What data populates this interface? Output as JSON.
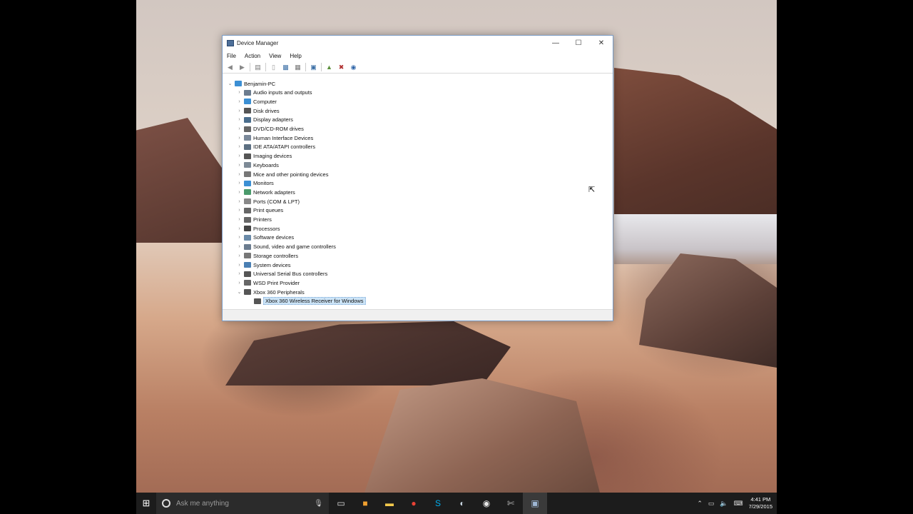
{
  "window": {
    "title": "Device Manager",
    "minimize": "—",
    "maximize": "☐",
    "close": "✕"
  },
  "menu": [
    "File",
    "Action",
    "View",
    "Help"
  ],
  "tree": {
    "root": "Benjamin-PC",
    "categories": [
      {
        "label": "Audio inputs and outputs",
        "icon": "speaker-icon",
        "color": "#6b7c8f"
      },
      {
        "label": "Computer",
        "icon": "computer-icon",
        "color": "#3b8fd4"
      },
      {
        "label": "Disk drives",
        "icon": "disk-drive-icon",
        "color": "#555555"
      },
      {
        "label": "Display adapters",
        "icon": "display-adapter-icon",
        "color": "#4a6d8c"
      },
      {
        "label": "DVD/CD-ROM drives",
        "icon": "dvd-drive-icon",
        "color": "#666666"
      },
      {
        "label": "Human Interface Devices",
        "icon": "hid-icon",
        "color": "#7a8899"
      },
      {
        "label": "IDE ATA/ATAPI controllers",
        "icon": "ide-controller-icon",
        "color": "#5c6f82"
      },
      {
        "label": "Imaging devices",
        "icon": "camera-icon",
        "color": "#555555"
      },
      {
        "label": "Keyboards",
        "icon": "keyboard-icon",
        "color": "#7d8a96"
      },
      {
        "label": "Mice and other pointing devices",
        "icon": "mouse-icon",
        "color": "#777777"
      },
      {
        "label": "Monitors",
        "icon": "monitor-icon",
        "color": "#3b8fd4"
      },
      {
        "label": "Network adapters",
        "icon": "network-adapter-icon",
        "color": "#4a9a6b"
      },
      {
        "label": "Ports (COM & LPT)",
        "icon": "port-icon",
        "color": "#888888"
      },
      {
        "label": "Print queues",
        "icon": "print-queue-icon",
        "color": "#666666"
      },
      {
        "label": "Printers",
        "icon": "printer-icon",
        "color": "#666666"
      },
      {
        "label": "Processors",
        "icon": "processor-icon",
        "color": "#444444"
      },
      {
        "label": "Software devices",
        "icon": "software-device-icon",
        "color": "#6a8aa8"
      },
      {
        "label": "Sound, video and game controllers",
        "icon": "sound-icon",
        "color": "#6b7c8f"
      },
      {
        "label": "Storage controllers",
        "icon": "storage-controller-icon",
        "color": "#777777"
      },
      {
        "label": "System devices",
        "icon": "system-device-icon",
        "color": "#4a7fb3"
      },
      {
        "label": "Universal Serial Bus controllers",
        "icon": "usb-icon",
        "color": "#555555"
      },
      {
        "label": "WSD Print Provider",
        "icon": "wsd-print-icon",
        "color": "#666666"
      },
      {
        "label": "Xbox 360 Peripherals",
        "icon": "gamepad-icon",
        "color": "#555555",
        "expanded": true
      }
    ],
    "selected_child": "Xbox 360 Wireless Receiver for Windows"
  },
  "taskbar": {
    "search_placeholder": "Ask me anything",
    "apps": [
      {
        "name": "task-view-icon",
        "glyph": "▭",
        "color": "#dddddd"
      },
      {
        "name": "store-icon",
        "glyph": "■",
        "color": "#f0a030"
      },
      {
        "name": "file-explorer-icon",
        "glyph": "▬",
        "color": "#f2c94c"
      },
      {
        "name": "chrome-icon",
        "glyph": "●",
        "color": "#e94235"
      },
      {
        "name": "skype-icon",
        "glyph": "S",
        "color": "#00aff0"
      },
      {
        "name": "steam-icon",
        "glyph": "◐",
        "color": "#c7d5e0"
      },
      {
        "name": "globe-icon",
        "glyph": "◉",
        "color": "#e6e6e6"
      },
      {
        "name": "tools-icon",
        "glyph": "✄",
        "color": "#bbbbbb"
      },
      {
        "name": "device-manager-icon",
        "glyph": "▣",
        "color": "#9fb7d4"
      }
    ],
    "time": "4:41 PM",
    "date": "7/29/2015"
  }
}
